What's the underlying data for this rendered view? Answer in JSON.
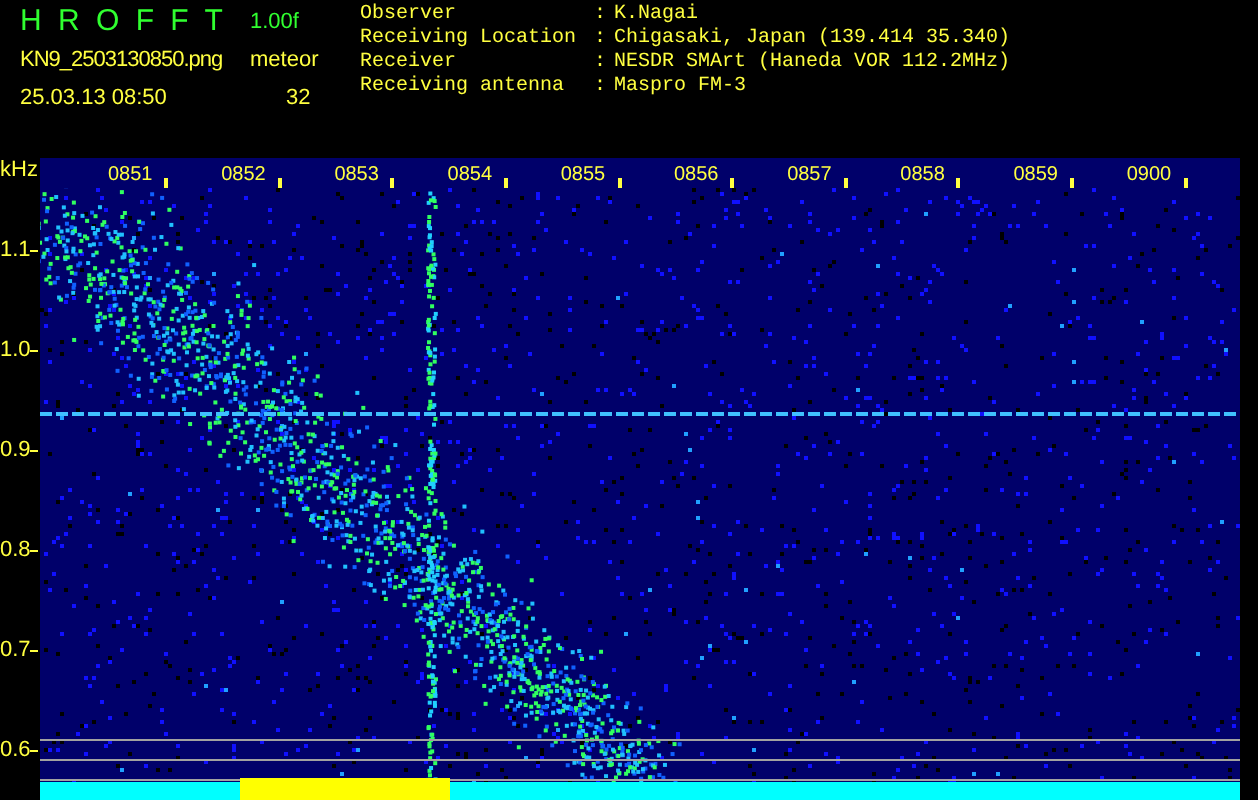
{
  "header": {
    "title": "H R O F F T",
    "version": "1.00f",
    "filename": "KN9_2503130850.png",
    "mode": "meteor",
    "datetime": "25.03.13 08:50",
    "count": "32"
  },
  "info": [
    {
      "label": "Observer",
      "separator": ":",
      "value": "K.Nagai"
    },
    {
      "label": "Receiving Location",
      "separator": ":",
      "value": "Chigasaki, Japan (139.414 35.340)"
    },
    {
      "label": "Receiver",
      "separator": ":",
      "value": "NESDR SMArt (Haneda VOR 112.2MHz)"
    },
    {
      "label": "Receiving antenna",
      "separator": ":",
      "value": "Maspro FM-3"
    }
  ],
  "y_axis": {
    "unit": "kHz",
    "labels": [
      "1.1",
      "1.0",
      "0.9",
      "0.8",
      "0.7",
      "0.6"
    ]
  },
  "time_labels": [
    "0851",
    "0852",
    "0853",
    "0854",
    "0855",
    "0856",
    "0857",
    "0858",
    "0859",
    "0900"
  ]
}
